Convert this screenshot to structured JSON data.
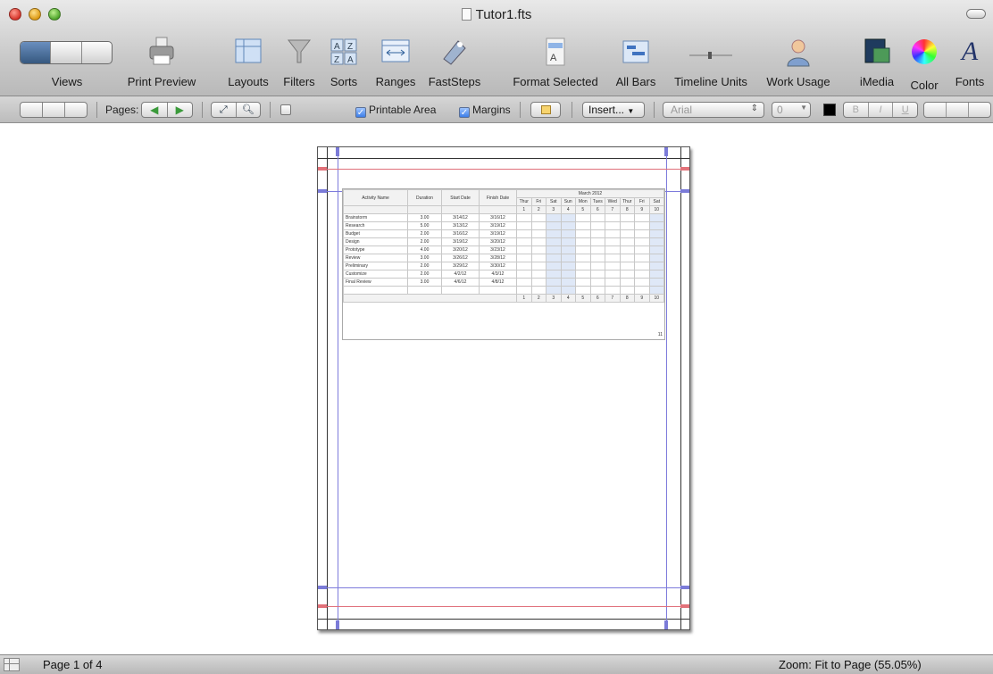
{
  "window": {
    "title": "Tutor1.fts"
  },
  "toolbar": {
    "views": "Views",
    "print_preview": "Print Preview",
    "layouts": "Layouts",
    "filters": "Filters",
    "sorts": "Sorts",
    "ranges": "Ranges",
    "faststeps": "FastSteps",
    "format_selected": "Format Selected",
    "all_bars": "All Bars",
    "timeline_units": "Timeline Units",
    "work_usage": "Work Usage",
    "imedia": "iMedia",
    "color": "Color",
    "fonts": "Fonts"
  },
  "formatbar": {
    "pages_label": "Pages:",
    "printable_area": "Printable Area",
    "margins": "Margins",
    "insert": "Insert...",
    "font": "Arial",
    "size": "0",
    "bold": "B",
    "italic": "I",
    "underline": "U"
  },
  "gantt": {
    "headers": [
      "Activity Name",
      "Duration",
      "Start Date",
      "Finish Date"
    ],
    "month": "March 2012",
    "days": [
      "Thur",
      "Fri",
      "Sat",
      "Sun",
      "Mon",
      "Tues",
      "Wed",
      "Thur",
      "Fri",
      "Sat"
    ],
    "day_numbers": [
      "1",
      "2",
      "3",
      "4",
      "5",
      "6",
      "7",
      "8",
      "9",
      "10"
    ],
    "footer_numbers": [
      "1",
      "2",
      "3",
      "4",
      "5",
      "6",
      "7",
      "8",
      "9",
      "10",
      "11"
    ],
    "rows": [
      {
        "name": "Brainstorm",
        "duration": "3.00",
        "start": "3/14/12",
        "finish": "3/16/12"
      },
      {
        "name": "Research",
        "duration": "5.00",
        "start": "3/13/12",
        "finish": "3/19/12"
      },
      {
        "name": "Budget",
        "duration": "2.00",
        "start": "3/16/12",
        "finish": "3/19/12"
      },
      {
        "name": "Design",
        "duration": "2.00",
        "start": "3/19/12",
        "finish": "3/20/12"
      },
      {
        "name": "Prototype",
        "duration": "4.00",
        "start": "3/20/12",
        "finish": "3/23/12"
      },
      {
        "name": "Review",
        "duration": "3.00",
        "start": "3/26/12",
        "finish": "3/28/12"
      },
      {
        "name": "Preliminary",
        "duration": "2.00",
        "start": "3/29/12",
        "finish": "3/30/12"
      },
      {
        "name": "Customize",
        "duration": "2.00",
        "start": "4/2/12",
        "finish": "4/3/12"
      },
      {
        "name": "Final Review",
        "duration": "3.00",
        "start": "4/6/12",
        "finish": "4/8/12"
      }
    ]
  },
  "statusbar": {
    "page": "Page 1 of 4",
    "zoom": "Zoom: Fit to Page (55.05%)"
  }
}
